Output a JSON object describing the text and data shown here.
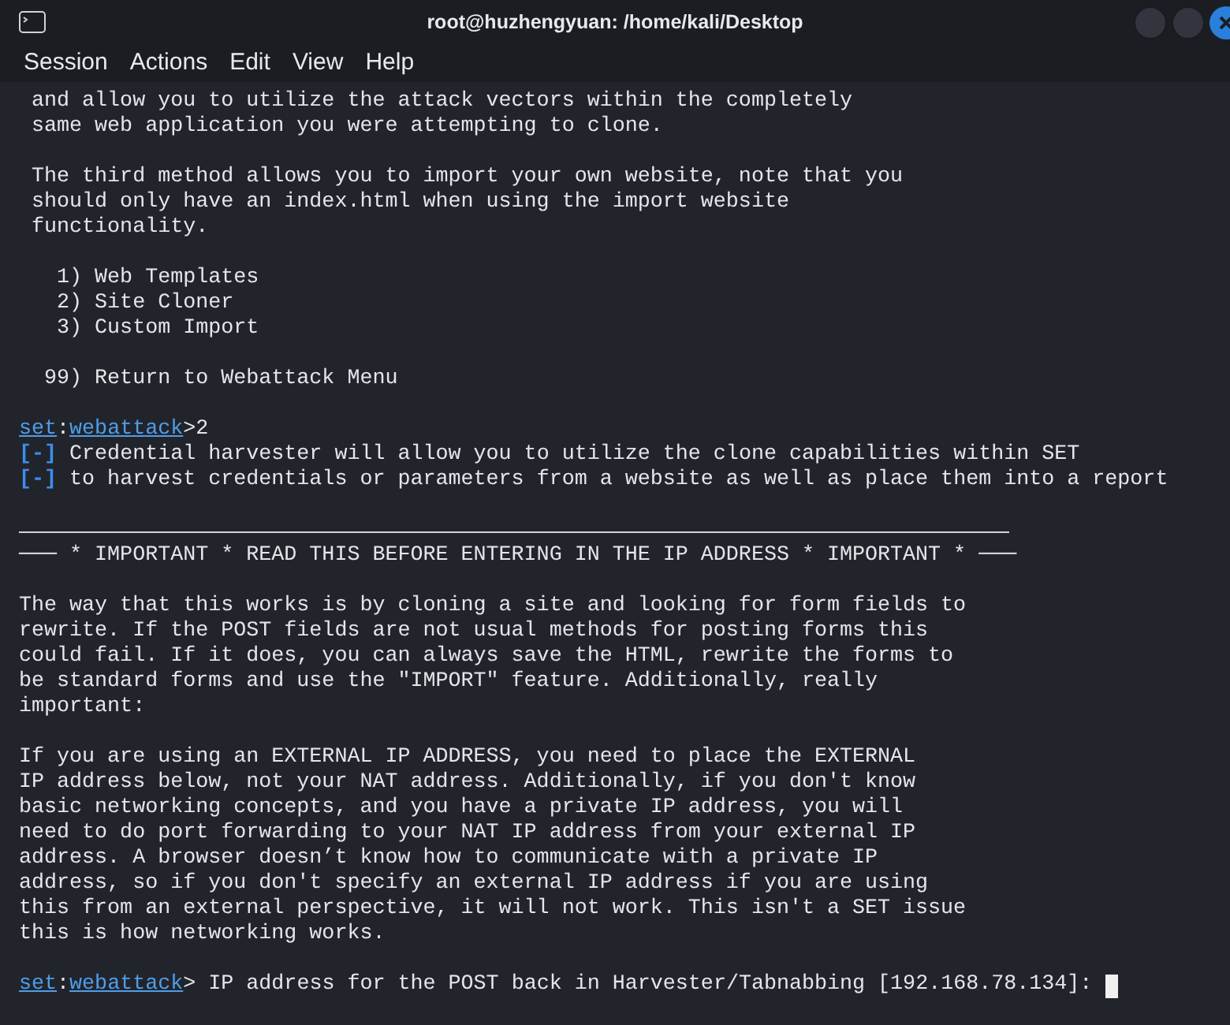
{
  "window": {
    "title": "root@huzhengyuan: /home/kali/Desktop"
  },
  "menu": [
    "Session",
    "Actions",
    "Edit",
    "View",
    "Help"
  ],
  "lines": [
    {
      "kind": "text",
      "text": " and allow you to utilize the attack vectors within the completely"
    },
    {
      "kind": "text",
      "text": " same web application you were attempting to clone."
    },
    {
      "kind": "blank"
    },
    {
      "kind": "text",
      "text": " The third method allows you to import your own website, note that you"
    },
    {
      "kind": "text",
      "text": " should only have an index.html when using the import website"
    },
    {
      "kind": "text",
      "text": " functionality."
    },
    {
      "kind": "blank"
    },
    {
      "kind": "text",
      "text": "   1) Web Templates"
    },
    {
      "kind": "text",
      "text": "   2) Site Cloner"
    },
    {
      "kind": "text",
      "text": "   3) Custom Import"
    },
    {
      "kind": "blank"
    },
    {
      "kind": "text",
      "text": "  99) Return to Webattack Menu"
    },
    {
      "kind": "blank"
    },
    {
      "kind": "prompt",
      "host": "set",
      "sep": ":",
      "module": "webattack",
      "input": ">2",
      "cursor": false
    },
    {
      "kind": "info",
      "marker": "[-]",
      "text": " Credential harvester will allow you to utilize the clone capabilities within SET"
    },
    {
      "kind": "info",
      "marker": "[-]",
      "text": " to harvest credentials or parameters from a website as well as place them into a report"
    },
    {
      "kind": "blank"
    },
    {
      "kind": "rule"
    },
    {
      "kind": "text",
      "text": "─── * IMPORTANT * READ THIS BEFORE ENTERING IN THE IP ADDRESS * IMPORTANT * ───"
    },
    {
      "kind": "blank"
    },
    {
      "kind": "text",
      "text": "The way that this works is by cloning a site and looking for form fields to"
    },
    {
      "kind": "text",
      "text": "rewrite. If the POST fields are not usual methods for posting forms this"
    },
    {
      "kind": "text",
      "text": "could fail. If it does, you can always save the HTML, rewrite the forms to"
    },
    {
      "kind": "text",
      "text": "be standard forms and use the \"IMPORT\" feature. Additionally, really"
    },
    {
      "kind": "text",
      "text": "important:"
    },
    {
      "kind": "blank"
    },
    {
      "kind": "text",
      "text": "If you are using an EXTERNAL IP ADDRESS, you need to place the EXTERNAL"
    },
    {
      "kind": "text",
      "text": "IP address below, not your NAT address. Additionally, if you don't know"
    },
    {
      "kind": "text",
      "text": "basic networking concepts, and you have a private IP address, you will"
    },
    {
      "kind": "text",
      "text": "need to do port forwarding to your NAT IP address from your external IP"
    },
    {
      "kind": "text",
      "text": "address. A browser doesn’t know how to communicate with a private IP"
    },
    {
      "kind": "text",
      "text": "address, so if you don't specify an external IP address if you are using"
    },
    {
      "kind": "text",
      "text": "this from an external perspective, it will not work. This isn't a SET issue"
    },
    {
      "kind": "text",
      "text": "this is how networking works."
    },
    {
      "kind": "blank"
    },
    {
      "kind": "prompt",
      "host": "set",
      "sep": ":",
      "module": "webattack",
      "input": "> IP address for the POST back in Harvester/Tabnabbing [192.168.78.134]: ",
      "cursor": true
    }
  ]
}
